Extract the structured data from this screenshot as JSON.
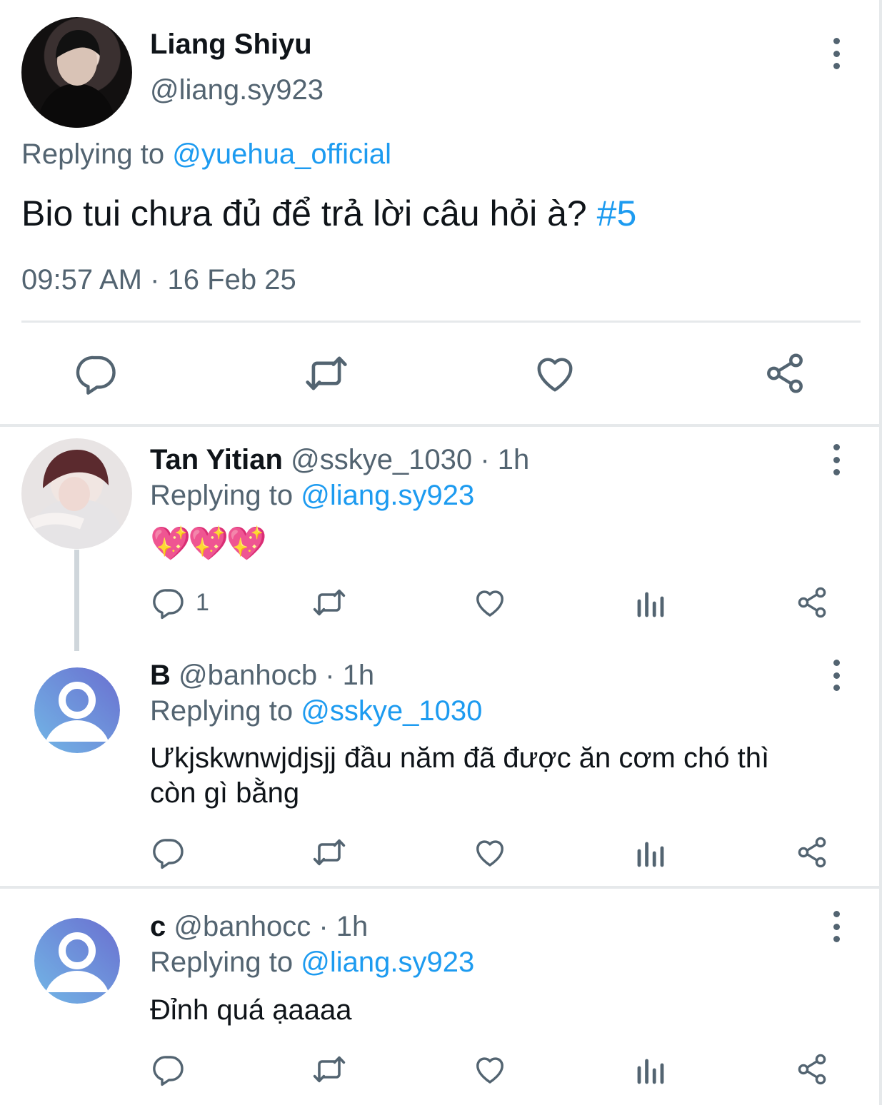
{
  "main_tweet": {
    "author_name": "Liang Shiyu",
    "handle": "@liang.sy923",
    "replying_prefix": "Replying to",
    "replying_to": "@yuehua_official",
    "text": "Bio tui chưa đủ để trả lời câu hỏi à?",
    "hashtag": "#5",
    "timestamp": "09:57 AM · 16 Feb 25",
    "actions": [
      "reply-icon",
      "retweet-icon",
      "like-icon",
      "share-icon"
    ]
  },
  "replies": [
    {
      "author_name": "Tan Yitian",
      "handle": "@sskye_1030",
      "time": "· 1h",
      "replying_prefix": "Replying to",
      "replying_to": "@liang.sy923",
      "text": "💖💖💖",
      "reply_count": "1"
    },
    {
      "author_name": "B",
      "handle": "@banhocb",
      "time": "· 1h",
      "replying_prefix": "Replying to",
      "replying_to": "@sskye_1030",
      "text_line1": "Ưkjskwnwjdjsjj đầu năm đã được ăn cơm chó thì",
      "text_line2": "còn gì bằng"
    },
    {
      "author_name": "c",
      "handle": "@banhocc",
      "time": "· 1h",
      "replying_prefix": "Replying to",
      "replying_to": "@liang.sy923",
      "text": "Đỉnh quá ạaaaa"
    }
  ],
  "colors": {
    "accent": "#1d9bf0",
    "muted": "#536471",
    "text": "#0f1419",
    "divider": "#e6e9eb"
  }
}
